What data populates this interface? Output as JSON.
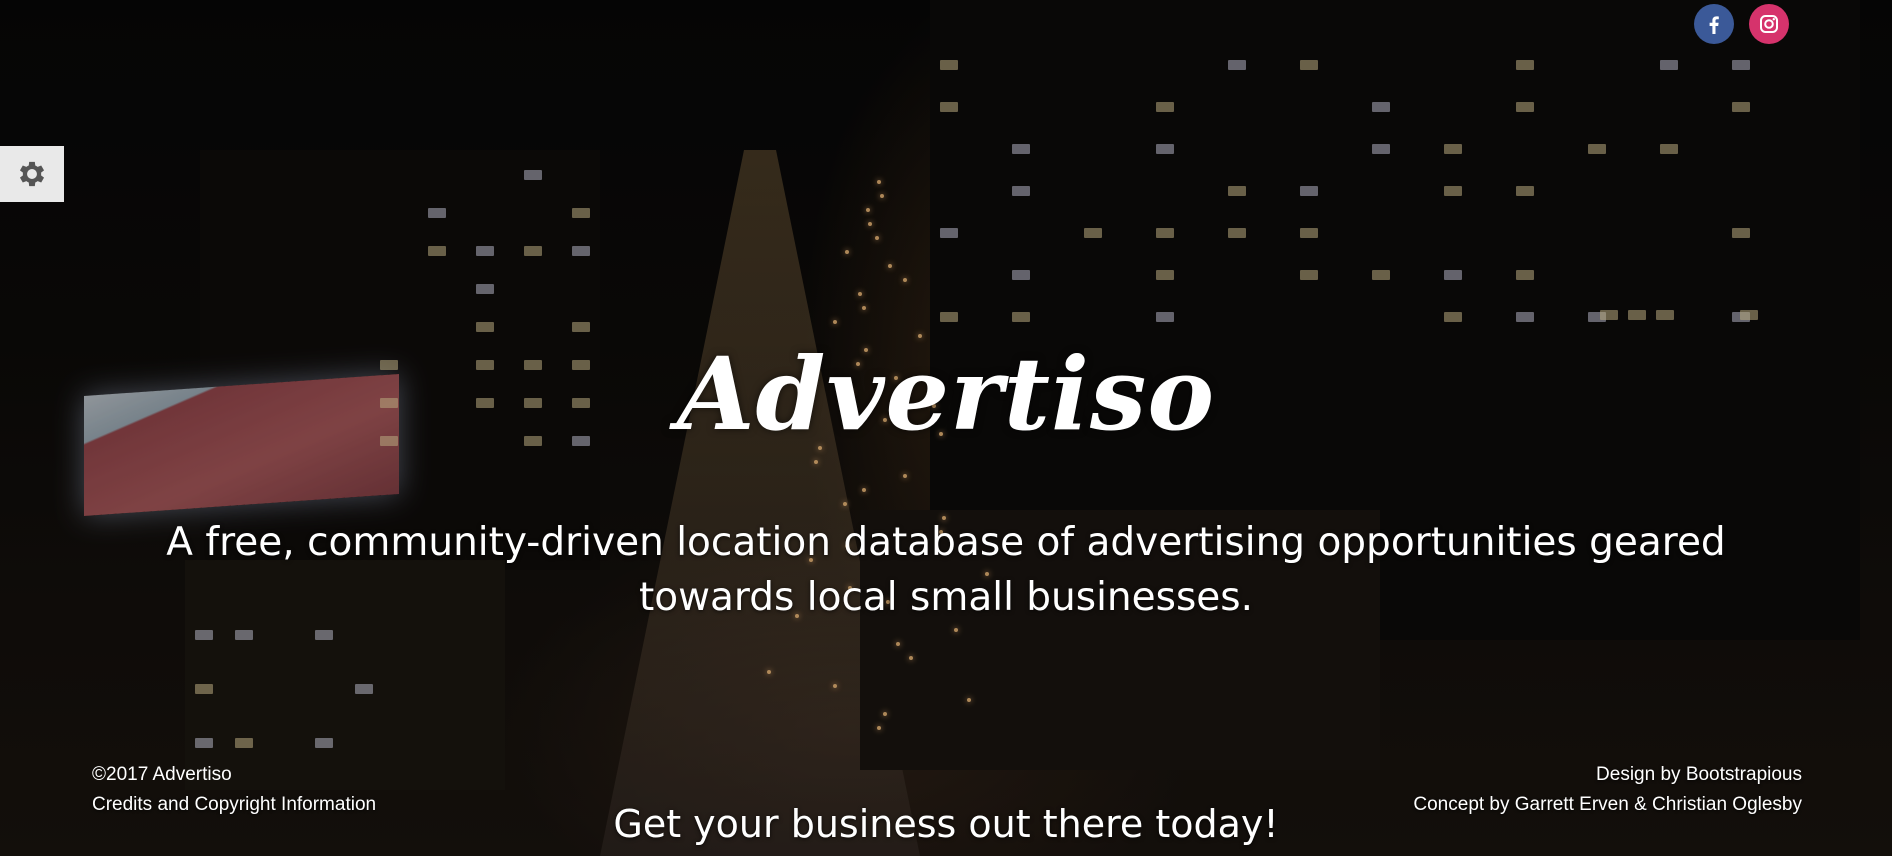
{
  "hero": {
    "logo": "Advertiso",
    "tagline": "A free, community-driven location database of advertising opportunities geared towards local small businesses.",
    "cta": "Get your business out there today!"
  },
  "social": [
    {
      "icon": "facebook-icon",
      "color": "#3b5998"
    },
    {
      "icon": "instagram-icon",
      "color": "#d6336c"
    }
  ],
  "settings": {
    "icon": "gear-icon"
  },
  "footer": {
    "copyright": "©2017 Advertiso",
    "credits_link": "Credits and Copyright Information",
    "design": "Design by Bootstrapious",
    "concept": "Concept by Garrett Erven & Christian Oglesby"
  }
}
